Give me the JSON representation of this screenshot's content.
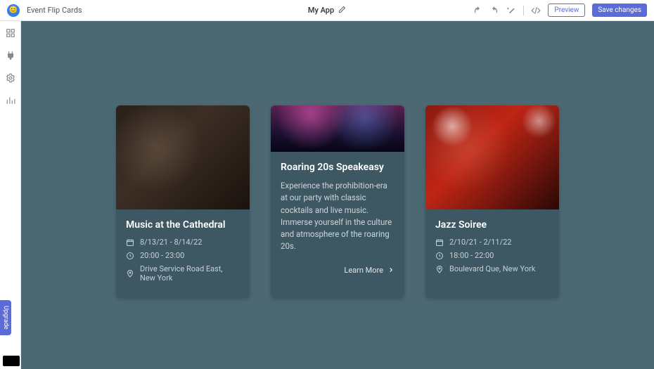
{
  "header": {
    "project": "Event Flip Cards",
    "app_name": "My App",
    "preview": "Preview",
    "save": "Save changes"
  },
  "upgrade": "Upgrade",
  "cards": [
    {
      "title": "Music at the Cathedral",
      "date": "8/13/21 - 8/14/22",
      "time": "20:00 - 23:00",
      "location": "Drive Service Road East, New York"
    },
    {
      "title": "Roaring 20s Speakeasy",
      "desc": "Experience the prohibition-era at our party with classic cocktails and live music. Immerse yourself in the culture and atmosphere of the roaring 20s.",
      "learn_more": "Learn More"
    },
    {
      "title": "Jazz Soiree",
      "date": "2/10/21 - 2/11/22",
      "time": "18:00 - 22:00",
      "location": "Boulevard Que, New York"
    }
  ]
}
